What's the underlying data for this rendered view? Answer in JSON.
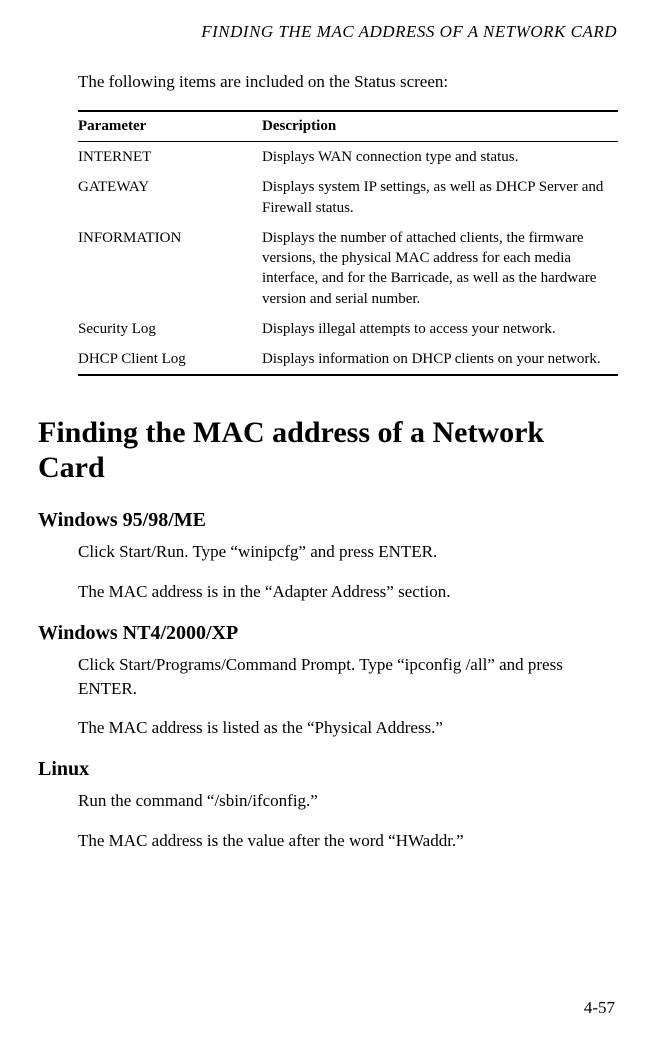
{
  "runningHead": "FINDING THE MAC ADDRESS OF A NETWORK CARD",
  "intro": "The following items are included on the Status screen:",
  "table": {
    "headers": [
      "Parameter",
      "Description"
    ],
    "rows": [
      {
        "param": "INTERNET",
        "desc": "Displays WAN connection type and status."
      },
      {
        "param": "GATEWAY",
        "desc": "Displays system IP settings, as well as DHCP Server and Firewall status."
      },
      {
        "param": "INFORMATION",
        "desc": "Displays the number of attached clients, the firmware versions, the physical MAC address for each media interface, and for the Barricade, as well as the hardware version and serial number."
      },
      {
        "param": "Security Log",
        "desc": "Displays illegal attempts to access your network."
      },
      {
        "param": "DHCP Client Log",
        "desc": "Displays information on DHCP clients on your network."
      }
    ]
  },
  "h1": "Finding the MAC address of a Network Card",
  "sections": [
    {
      "heading": "Windows 95/98/ME",
      "paras": [
        "Click Start/Run. Type “winipcfg” and press ENTER.",
        "The MAC address is in the “Adapter Address” section."
      ]
    },
    {
      "heading": "Windows NT4/2000/XP",
      "paras": [
        "Click Start/Programs/Command Prompt. Type “ipconfig /all” and press ENTER.",
        "The MAC address is listed as the “Physical Address.”"
      ]
    },
    {
      "heading": "Linux",
      "paras": [
        "Run the command “/sbin/ifconfig.”",
        "The MAC address is the value after the word “HWaddr.”"
      ]
    }
  ],
  "pageNumber": "4-57"
}
